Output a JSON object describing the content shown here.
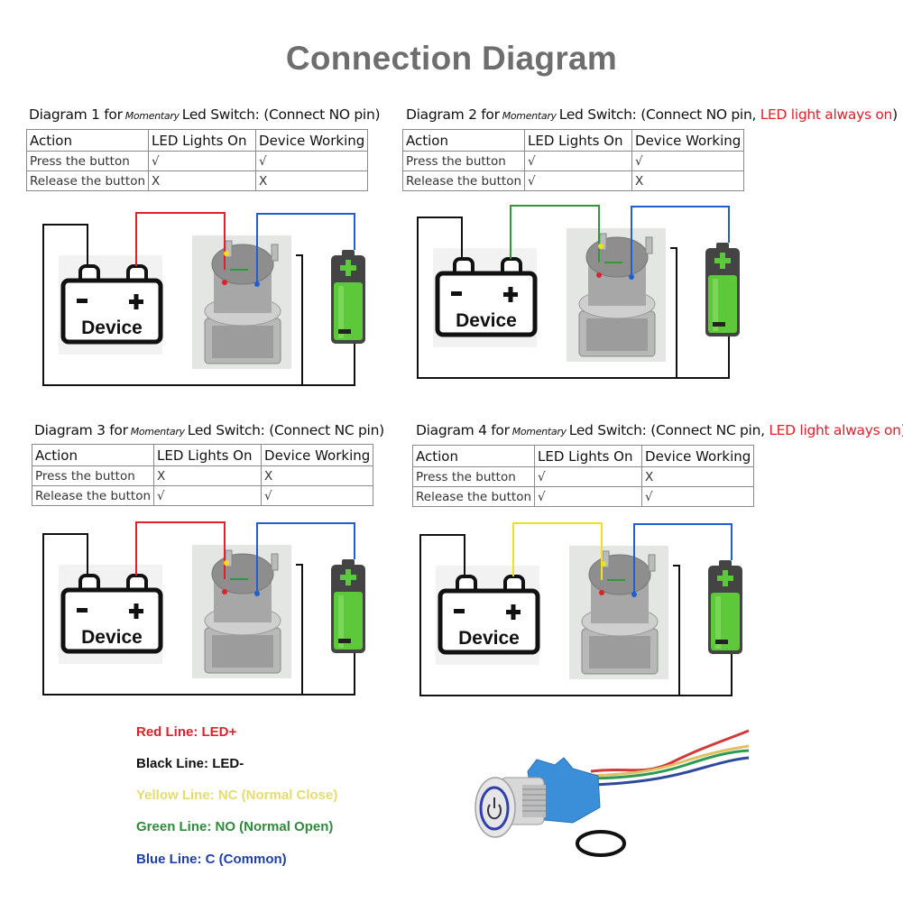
{
  "page_title": "Connection Diagram",
  "table_headers": [
    "Action",
    "LED Lights On",
    "Device Working"
  ],
  "diagrams": [
    {
      "prefix": "Diagram 1 for",
      "mode": "Momentary",
      "suffix": "Led Switch: (Connect NO pin)",
      "note": "",
      "note_close": "",
      "rows": [
        {
          "action": "Press the button",
          "led": "√",
          "device": "√"
        },
        {
          "action": "Release the button",
          "led": "X",
          "device": "X"
        }
      ],
      "wire_to_device_plus": "red",
      "device_label": "Device",
      "device_minus": "−",
      "device_plus": "+"
    },
    {
      "prefix": "Diagram 2 for",
      "mode": "Momentary",
      "suffix": "Led Switch: (Connect NO pin, ",
      "note": "LED light always on",
      "note_close": ")",
      "rows": [
        {
          "action": "Press the button",
          "led": "√",
          "device": "√"
        },
        {
          "action": "Release the button",
          "led": "√",
          "device": "X"
        }
      ],
      "wire_to_device_plus": "green",
      "device_label": "Device",
      "device_minus": "−",
      "device_plus": "+"
    },
    {
      "prefix": "Diagram 3 for",
      "mode": "Momentary",
      "suffix": "Led Switch: (Connect NC pin)",
      "note": "",
      "note_close": "",
      "rows": [
        {
          "action": "Press the button",
          "led": "X",
          "device": "X"
        },
        {
          "action": "Release the button",
          "led": "√",
          "device": "√"
        }
      ],
      "wire_to_device_plus": "red",
      "device_label": "Device",
      "device_minus": "−",
      "device_plus": "+"
    },
    {
      "prefix": "Diagram 4 for",
      "mode": "Momentary",
      "suffix": "Led Switch: (Connect NC pin, ",
      "note": "LED light always on",
      "note_close": ")",
      "rows": [
        {
          "action": "Press the button",
          "led": "√",
          "device": "X"
        },
        {
          "action": "Release the button",
          "led": "√",
          "device": "√"
        }
      ],
      "wire_to_device_plus": "yellow",
      "device_label": "Device",
      "device_minus": "−",
      "device_plus": "+"
    }
  ],
  "legend": [
    {
      "text": "Red Line: LED+",
      "color": "#e0202a"
    },
    {
      "text": "Black Line: LED-",
      "color": "#111111"
    },
    {
      "text": "Yellow Line: NC (Normal Close)",
      "color": "#e6dc6e"
    },
    {
      "text": "Green Line: NO (Normal Open)",
      "color": "#2e8b3a"
    },
    {
      "text": "Blue Line: C (Common)",
      "color": "#1f3fa8"
    }
  ],
  "colors": {
    "title": "#6e6e6e",
    "red": "#e0202a",
    "green": "#2e9a35",
    "yellow": "#f0e020",
    "blue": "#1f5fd0",
    "black": "#111111",
    "battery_green": "#5cc83a"
  }
}
